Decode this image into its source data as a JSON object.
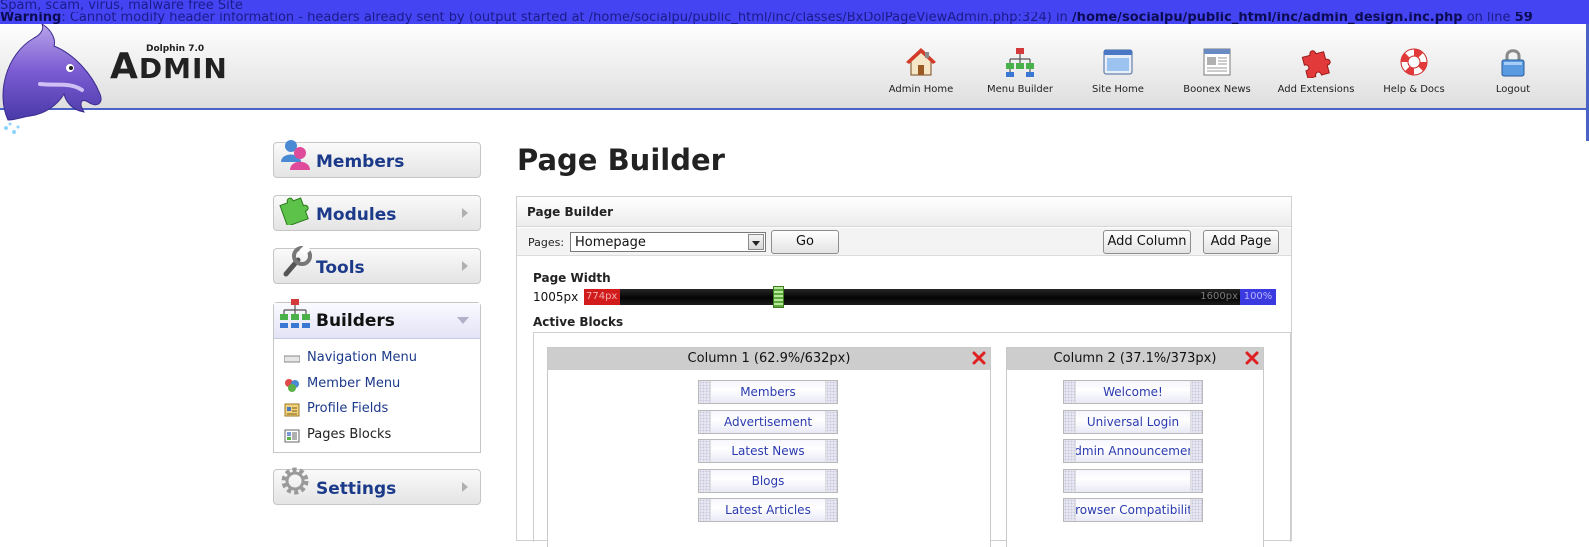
{
  "warning": {
    "line1": "Spam, scam, virus, malware free Site",
    "prefix": "Warning",
    "message": ": Cannot modify header information - headers already sent by (output started at /home/socialpu/public_html/inc/classes/BxDolPageViewAdmin.php:324) in ",
    "file": "/home/socialpu/public_html/inc/admin_design.inc.php",
    "on_line": " on line ",
    "line_no": "59"
  },
  "brand": {
    "version": "Dolphin 7.0",
    "name_first": "A",
    "name_rest": "DMIN"
  },
  "topnav": [
    {
      "label": "Admin Home",
      "icon": "house-icon"
    },
    {
      "label": "Menu Builder",
      "icon": "sitemap-icon"
    },
    {
      "label": "Site Home",
      "icon": "browser-window-icon"
    },
    {
      "label": "Boonex News",
      "icon": "newspaper-icon"
    },
    {
      "label": "Add Extensions",
      "icon": "puzzle-icon"
    },
    {
      "label": "Help & Docs",
      "icon": "lifebuoy-icon"
    },
    {
      "label": "Logout",
      "icon": "padlock-icon"
    }
  ],
  "sidebar": {
    "members": "Members",
    "modules": "Modules",
    "tools": "Tools",
    "builders": "Builders",
    "settings": "Settings",
    "builders_items": [
      {
        "label": "Navigation Menu",
        "icon": "nav-menu-icon"
      },
      {
        "label": "Member Menu",
        "icon": "member-menu-icon"
      },
      {
        "label": "Profile Fields",
        "icon": "profile-fields-icon"
      },
      {
        "label": "Pages Blocks",
        "icon": "pages-blocks-icon"
      }
    ]
  },
  "main": {
    "title": "Page Builder",
    "panel_title": "Page Builder",
    "pages_label": "Pages:",
    "pages_selected": "Homepage",
    "go_label": "Go",
    "add_column_label": "Add Column",
    "add_page_label": "Add Page",
    "page_width_label": "Page Width",
    "page_width_value": "1005px",
    "slider": {
      "min_label": "774px",
      "max_px_label": "1600px",
      "max_label": "100%",
      "min": 774,
      "max": 1600,
      "value": 1005
    },
    "active_blocks_label": "Active Blocks",
    "columns": [
      {
        "header": "Column 1 (62.9%/632px)",
        "blocks": [
          "Members",
          "Advertisement",
          "Latest News",
          "Blogs",
          "Latest Articles"
        ]
      },
      {
        "header": "Column 2 (37.1%/373px)",
        "blocks": [
          "Welcome!",
          "Universal Login",
          "Admin Announcement",
          "",
          "Browser Compatibility"
        ]
      }
    ]
  }
}
